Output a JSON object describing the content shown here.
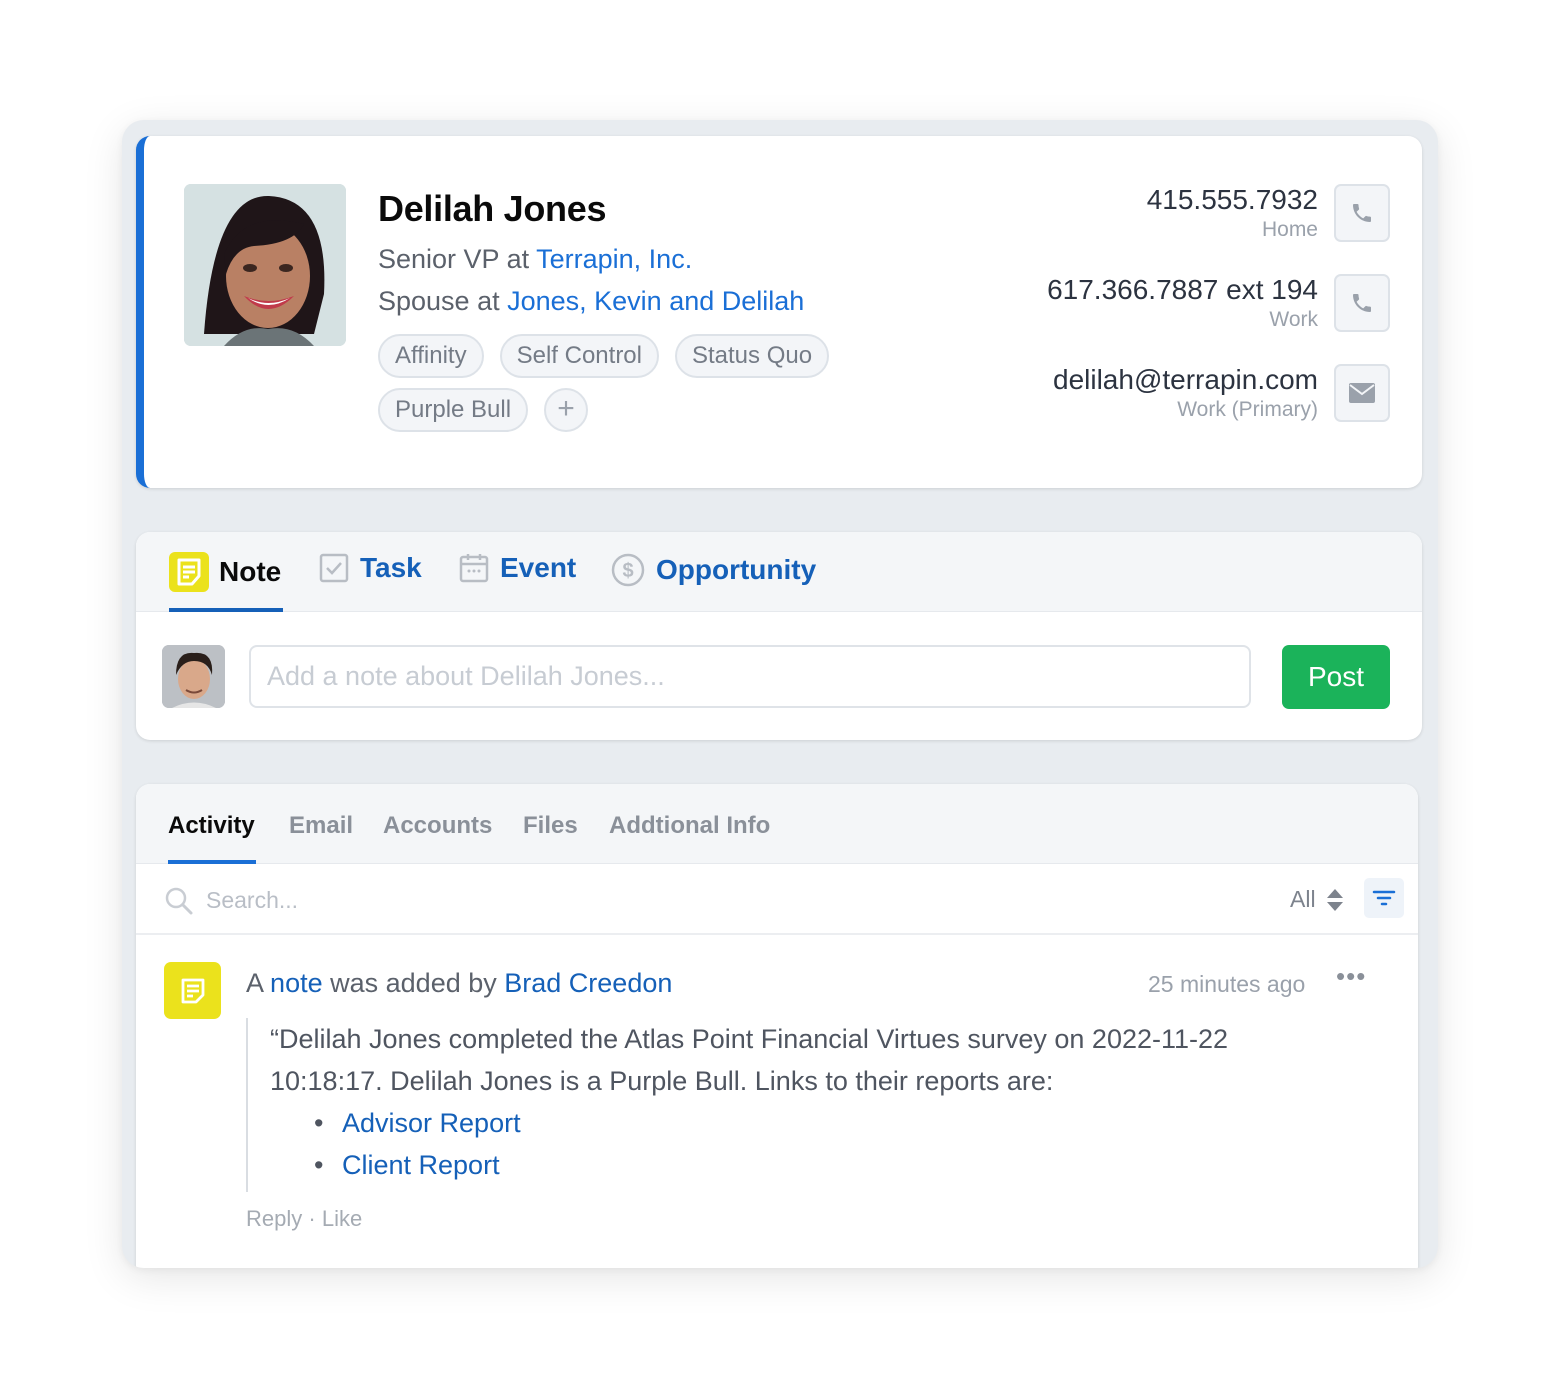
{
  "contact": {
    "name": "Delilah Jones",
    "roles": [
      {
        "prefix": "Senior VP at",
        "link": "Terrapin, Inc."
      },
      {
        "prefix": "Spouse at",
        "link": "Jones, Kevin and Delilah"
      }
    ],
    "tags": [
      "Affinity",
      "Self Control",
      "Status Quo",
      "Purple Bull"
    ],
    "add_tag_label": "+",
    "methods": [
      {
        "value": "415.555.7932",
        "label": "Home",
        "icon": "phone-icon"
      },
      {
        "value": "617.366.7887 ext 194",
        "label": "Work",
        "icon": "phone-icon"
      },
      {
        "value": "delilah@terrapin.com",
        "label": "Work (Primary)",
        "icon": "mail-icon"
      }
    ],
    "accent_color": "#1a6fd6"
  },
  "composer": {
    "tabs": [
      {
        "label": "Note",
        "icon": "note-icon",
        "active": true
      },
      {
        "label": "Task",
        "icon": "checkbox-icon"
      },
      {
        "label": "Event",
        "icon": "calendar-icon"
      },
      {
        "label": "Opportunity",
        "icon": "dollar-circle-icon"
      }
    ],
    "placeholder": "Add a note about Delilah Jones...",
    "post_label": "Post",
    "post_color": "#1bb35a"
  },
  "activity": {
    "tabs": [
      "Activity",
      "Email",
      "Accounts",
      "Files",
      "Addtional Info"
    ],
    "active_tab": "Activity",
    "search_placeholder": "Search...",
    "filter_value": "All",
    "feed": [
      {
        "prefix": "A",
        "object_link": "note",
        "middle": "was added by",
        "author": "Brad Creedon",
        "time": "25 minutes ago",
        "more": "•••",
        "body": "“Delilah Jones completed the Atlas Point Financial Virtues survey on 2022-11-22 10:18:17. Delilah Jones is a Purple Bull. Links to their reports are:",
        "links": [
          "Advisor Report",
          "Client Report"
        ],
        "reply_label": "Reply",
        "separator": "·",
        "like_label": "Like"
      }
    ]
  }
}
